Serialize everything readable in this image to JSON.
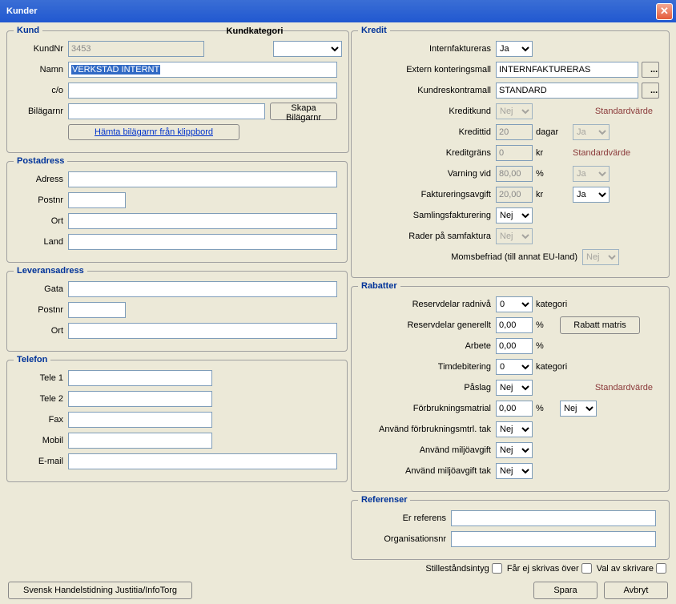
{
  "window": {
    "title": "Kunder"
  },
  "kund": {
    "legend": "Kund",
    "kundnr_label": "KundNr",
    "kundnr_value": "3453",
    "kundkategori_label": "Kundkategori",
    "namn_label": "Namn",
    "namn_value": "VERKSTAD INTERNT",
    "co_label": "c/o",
    "bilagarnr_label": "Bilägarnr",
    "skapa_btn": "Skapa Bilägarnr",
    "hamta_btn": "Hämta bilägarnr från klippbord"
  },
  "postadress": {
    "legend": "Postadress",
    "adress_label": "Adress",
    "postnr_label": "Postnr",
    "ort_label": "Ort",
    "land_label": "Land"
  },
  "leveransadress": {
    "legend": "Leveransadress",
    "gata_label": "Gata",
    "postnr_label": "Postnr",
    "ort_label": "Ort"
  },
  "telefon": {
    "legend": "Telefon",
    "tele1_label": "Tele 1",
    "tele2_label": "Tele 2",
    "fax_label": "Fax",
    "mobil_label": "Mobil",
    "email_label": "E-mail"
  },
  "kredit": {
    "legend": "Kredit",
    "internfaktureras_label": "Internfaktureras",
    "internfaktureras_value": "Ja",
    "extern_label": "Extern konteringsmall",
    "extern_value": "INTERNFAKTURERAS",
    "kundreskontra_label": "Kundreskontramall",
    "kundreskontra_value": "STANDARD",
    "kreditkund_label": "Kreditkund",
    "kreditkund_value": "Nej",
    "std_label": "Standardvärde",
    "kredittid_label": "Kredittid",
    "kredittid_value": "20",
    "dagar": "dagar",
    "dagar_sel": "Ja",
    "kreditgrans_label": "Kreditgräns",
    "kreditgrans_value": "0",
    "kr": "kr",
    "varning_label": "Varning vid",
    "varning_value": "80,00",
    "pct": "%",
    "varning_sel": "Ja",
    "fakturering_label": "Faktureringsavgift",
    "fakturering_value": "20,00",
    "fakturering_sel": "Ja",
    "samlings_label": "Samlingsfakturering",
    "samlings_value": "Nej",
    "rader_label": "Rader på samfaktura",
    "rader_value": "Nej",
    "moms_label": "Momsbefriad (till annat EU-land)",
    "moms_value": "Nej"
  },
  "rabatter": {
    "legend": "Rabatter",
    "reservdelar_rad_label": "Reservdelar radnivå",
    "reservdelar_rad_value": "0",
    "kategori": "kategori",
    "reservdelar_gen_label": "Reservdelar generellt",
    "reservdelar_gen_value": "0,00",
    "pct": "%",
    "rabatt_btn": "Rabatt matris",
    "arbete_label": "Arbete",
    "arbete_value": "0,00",
    "timdebitering_label": "Timdebitering",
    "timdebitering_value": "0",
    "paslag_label": "Påslag",
    "paslag_value": "Nej",
    "std_label": "Standardvärde",
    "forbruk_label": "Förbrukningsmatrial",
    "forbruk_value": "0,00",
    "forbruk_sel": "Nej",
    "anvand_forbruk_label": "Använd förbrukningsmtrl. tak",
    "anvand_forbruk_value": "Nej",
    "anvand_miljo_label": "Använd miljöavgift",
    "anvand_miljo_value": "Nej",
    "anvand_miljo_tak_label": "Använd miljöavgift tak",
    "anvand_miljo_tak_value": "Nej"
  },
  "referenser": {
    "legend": "Referenser",
    "er_referens_label": "Er referens",
    "orgnr_label": "Organisationsnr"
  },
  "checks": {
    "stillestand": "Stilleståndsintyg",
    "far_ej": "Får ej skrivas över",
    "val_skrivare": "Val av skrivare"
  },
  "bottom": {
    "justitia_btn": "Svensk Handelstidning Justitia/InfoTorg",
    "spara_btn": "Spara",
    "avbryt_btn": "Avbryt"
  }
}
